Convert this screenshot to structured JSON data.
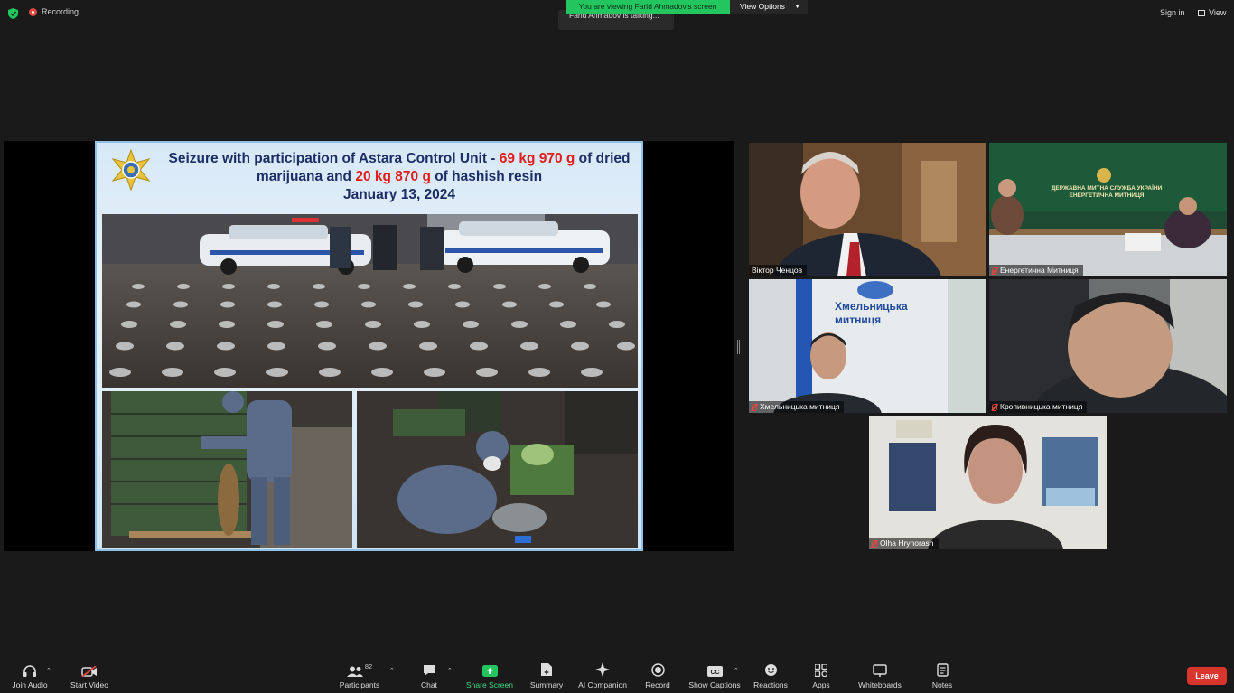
{
  "topbar": {
    "recording_label": "Recording",
    "viewing_banner": "You are viewing Farid Ahmadov's screen",
    "view_options_label": "View Options",
    "talking_indicator": "Farid Ahmadov is talking...",
    "sign_in_label": "Sign in",
    "view_label": "View"
  },
  "slide": {
    "title_part1": "Seizure with participation of Astara Control Unit - ",
    "title_red1": "69 kg 970 g",
    "title_part2": " of dried marijuana and ",
    "title_red2": "20 kg 870 g",
    "title_part3": " of hashish resin",
    "title_date": "January 13, 2024"
  },
  "participants": [
    {
      "name": "Віктор Ченцов",
      "muted": false
    },
    {
      "name": "Енергетична Митниця",
      "muted": true
    },
    {
      "name": "Хмельницька митниця",
      "muted": true
    },
    {
      "name": "Кропивницька митниця",
      "muted": true
    },
    {
      "name": "Olha Hryhorash",
      "muted": true
    }
  ],
  "tile_signage": {
    "energetic_wall_line1": "ДЕРЖАВНА МИТНА СЛУЖБА УКРАЇНИ",
    "energetic_wall_line2": "ЕНЕРГЕТИЧНА МИТНИЦЯ",
    "khmelnytska_wall_line1": "Хмельницька",
    "khmelnytska_wall_line2": "митниця"
  },
  "toolbar": {
    "join_audio": "Join Audio",
    "start_video": "Start Video",
    "participants": "Participants",
    "participants_count": "82",
    "chat": "Chat",
    "share_screen": "Share Screen",
    "summary": "Summary",
    "ai_companion": "AI Companion",
    "record": "Record",
    "show_captions": "Show Captions",
    "reactions": "Reactions",
    "apps": "Apps",
    "whiteboards": "Whiteboards",
    "notes": "Notes",
    "leave": "Leave"
  },
  "colors": {
    "banner_green": "#22c55e",
    "leave_red": "#d9352e",
    "share_green": "#3ddc84",
    "slide_title_blue": "#1d2d66",
    "slide_title_red": "#e11d1d"
  }
}
